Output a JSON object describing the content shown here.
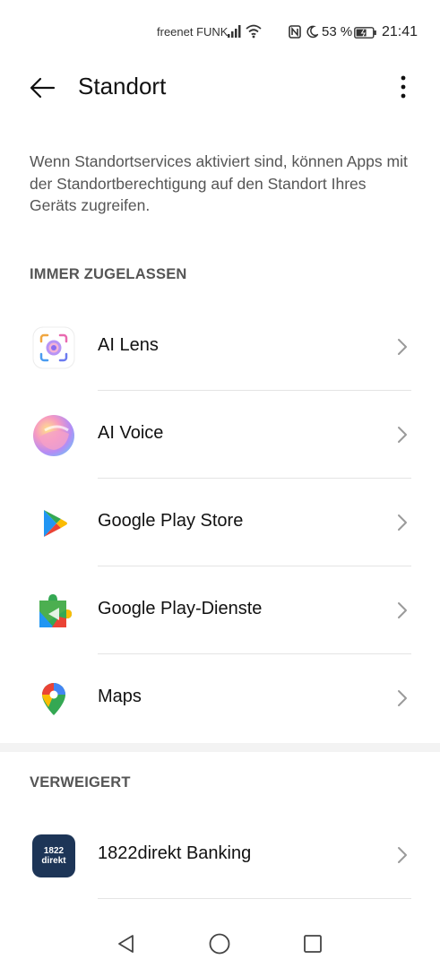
{
  "status_bar": {
    "carrier": "freenet FUNK",
    "battery_percent": "53 %",
    "time": "21:41"
  },
  "header": {
    "title": "Standort"
  },
  "intro_text": "Wenn Standortservices aktiviert sind, können Apps mit der Standortberechtigung auf den Standort Ihres Geräts zugreifen.",
  "sections": {
    "allowed": {
      "header": "IMMER ZUGELASSEN",
      "apps": [
        {
          "label": "AI Lens",
          "icon": "ai-lens-icon"
        },
        {
          "label": "AI Voice",
          "icon": "ai-voice-icon"
        },
        {
          "label": "Google Play Store",
          "icon": "google-play-store-icon"
        },
        {
          "label": "Google Play-Dienste",
          "icon": "google-play-services-icon"
        },
        {
          "label": "Maps",
          "icon": "maps-icon"
        }
      ]
    },
    "denied": {
      "header": "VERWEIGERT",
      "apps": [
        {
          "label": "1822direkt Banking",
          "icon": "1822direkt-icon",
          "icon_text": "1822 direkt"
        }
      ]
    }
  },
  "colors": {
    "background": "#ffffff",
    "section_header": "#555555",
    "divider": "#e4e4e4",
    "chevron": "#9a9a9a"
  }
}
